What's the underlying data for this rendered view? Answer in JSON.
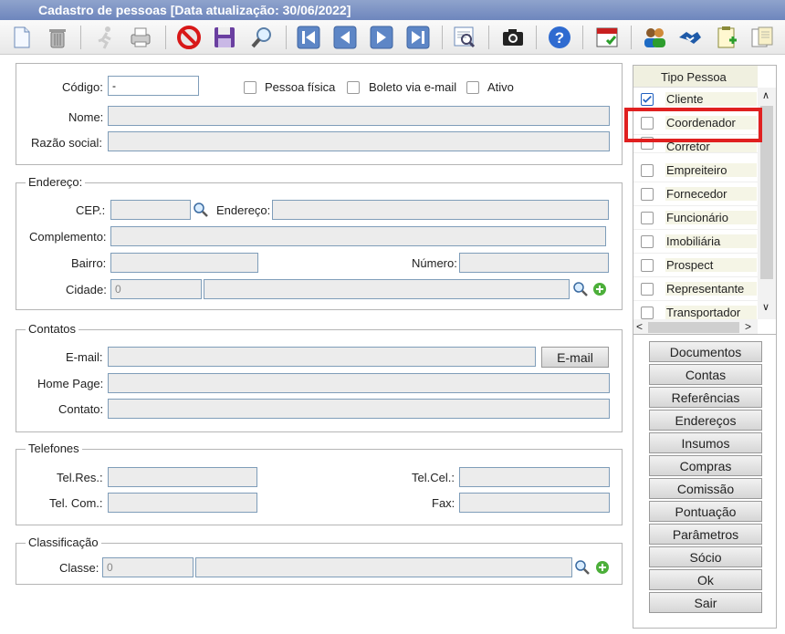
{
  "window": {
    "title": "Cadastro de pessoas [Data atualização: 30/06/2022]"
  },
  "toolbar": {
    "icons": [
      "new-icon",
      "trash-icon",
      "run-icon",
      "print-icon",
      "cancel-icon",
      "save-icon",
      "search-icon",
      "first-icon",
      "previous-icon",
      "next-icon",
      "last-icon",
      "preview-icon",
      "camera-icon",
      "help-icon",
      "calendar-icon",
      "users-icon",
      "handshake-icon",
      "clipboard-icon",
      "document-icon"
    ]
  },
  "main": {
    "codigo_label": "Código:",
    "codigo_value": "-",
    "pessoa_fisica": "Pessoa física",
    "boleto": "Boleto via e-mail",
    "ativo": "Ativo",
    "nome_label": "Nome:",
    "razao_label": "Razão social:"
  },
  "endereco": {
    "legend": "Endereço:",
    "cep_label": "CEP.:",
    "endereco_label": "Endereço:",
    "complemento_label": "Complemento:",
    "bairro_label": "Bairro:",
    "numero_label": "Número:",
    "cidade_label": "Cidade:",
    "cidade_value": "0"
  },
  "contatos": {
    "legend": "Contatos",
    "email_label": "E-mail:",
    "email_button": "E-mail",
    "homepage_label": "Home Page:",
    "contato_label": "Contato:"
  },
  "telefones": {
    "legend": "Telefones",
    "telres_label": "Tel.Res.:",
    "telcel_label": "Tel.Cel.:",
    "telcom_label": "Tel. Com.:",
    "fax_label": "Fax:"
  },
  "classificacao": {
    "legend": "Classificação",
    "classe_label": "Classe:",
    "classe_value": "0"
  },
  "tipo_pessoa": {
    "header": "Tipo Pessoa",
    "items": [
      {
        "label": "Cliente",
        "checked": true
      },
      {
        "label": "Coordenador",
        "checked": false
      },
      {
        "label": "Corretor",
        "checked": false
      },
      {
        "label": "Empreiteiro",
        "checked": false
      },
      {
        "label": "Fornecedor",
        "checked": false
      },
      {
        "label": "Funcionário",
        "checked": false
      },
      {
        "label": "Imobiliária",
        "checked": false
      },
      {
        "label": "Prospect",
        "checked": false
      },
      {
        "label": "Representante",
        "checked": false
      },
      {
        "label": "Transportador",
        "checked": false
      }
    ]
  },
  "side_buttons": [
    "Documentos",
    "Contas",
    "Referências",
    "Endereços",
    "Insumos",
    "Compras",
    "Comissão",
    "Pontuação",
    "Parâmetros",
    "Sócio",
    "Ok",
    "Sair"
  ],
  "colors": {
    "highlight": "#e02020",
    "check": "#2060c0"
  }
}
